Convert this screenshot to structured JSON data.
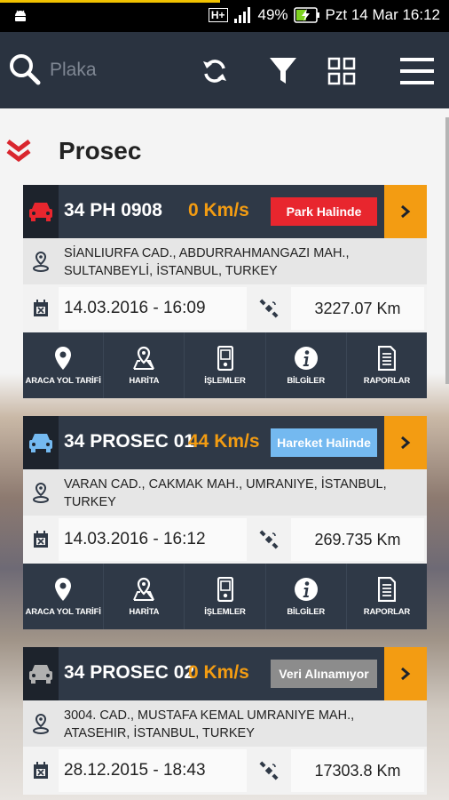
{
  "status_bar": {
    "network": "H+",
    "battery": "49%",
    "datetime": "Pzt 14 Mar 16:12"
  },
  "search": {
    "placeholder": "Plaka"
  },
  "group": {
    "title": "Prosec"
  },
  "actions": {
    "directions": "ARACA YOL TARİFİ",
    "map": "HARİTA",
    "operations": "İŞLEMLER",
    "info": "BİLGİLER",
    "reports": "RAPORLAR"
  },
  "vehicles": [
    {
      "plate": "34 PH 0908",
      "speed": "0 Km/s",
      "status": "Park Halinde",
      "status_color": "#e8262e",
      "car_color": "#e8262e",
      "address": "SİANLIURFA CAD., ABDURRAHMANGAZI MAH., SULTANBEYLİ, İSTANBUL, TURKEY",
      "date": "14.03.2016 - 16:09",
      "km": "3227.07 Km"
    },
    {
      "plate": "34 PROSEC 01",
      "speed": "44 Km/s",
      "status": "Hareket Halinde",
      "status_color": "#74b9f0",
      "car_color": "#74b9f0",
      "address": "VARAN CAD., CAKMAK MAH., UMRANIYE, İSTANBUL, TURKEY",
      "date": "14.03.2016 - 16:12",
      "km": "269.735 Km"
    },
    {
      "plate": "34 PROSEC 02",
      "speed": "0 Km/s",
      "status": "Veri Alınamıyor",
      "status_color": "#8c8c8c",
      "car_color": "#b0b0b0",
      "address": "3004. CAD., MUSTAFA KEMAL UMRANIYE MAH., ATASEHIR, İSTANBUL, TURKEY",
      "date": "28.12.2015 - 18:43",
      "km": "17303.8 Km"
    }
  ],
  "colors": {
    "appbar": "#2a3340",
    "accent": "#f39c12",
    "card_dark": "#2f3947"
  }
}
